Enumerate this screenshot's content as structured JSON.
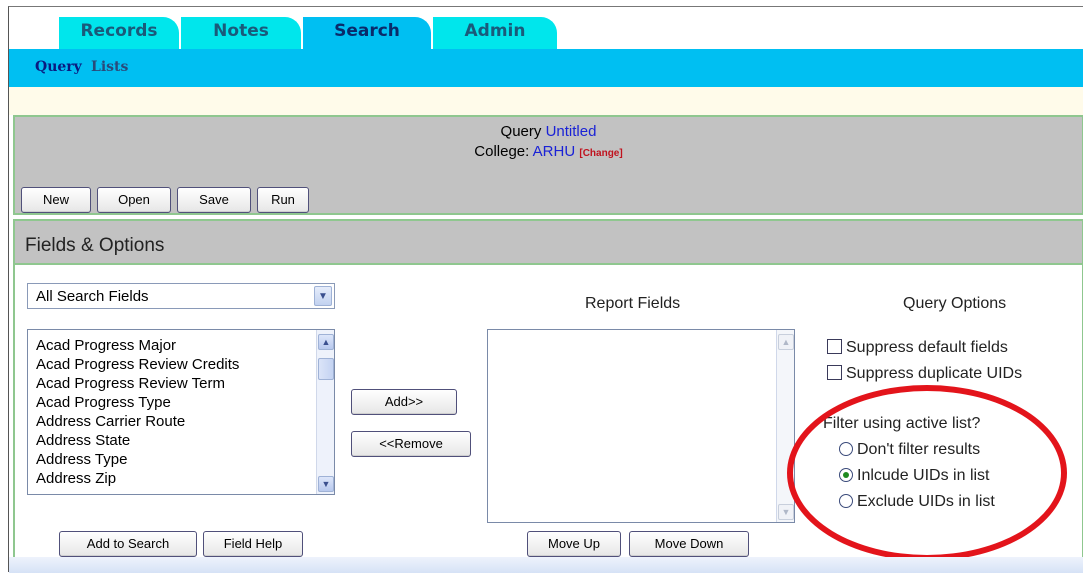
{
  "tabs": [
    {
      "label": "Records"
    },
    {
      "label": "Notes"
    },
    {
      "label": "Search"
    },
    {
      "label": "Admin"
    }
  ],
  "active_tab": "Search",
  "subnav": {
    "query": "Query",
    "lists": "Lists"
  },
  "query": {
    "prefix": "Query",
    "name": "Untitled",
    "college_label": "College:",
    "college": "ARHU",
    "change_link": "[Change]"
  },
  "toolbar": {
    "new": "New",
    "open": "Open",
    "save": "Save",
    "run": "Run"
  },
  "fields_section": {
    "title": "Fields & Options"
  },
  "field_select": {
    "selected": "All Search Fields"
  },
  "search_fields": [
    "Acad Progress Major",
    "Acad Progress Review Credits",
    "Acad Progress Review Term",
    "Acad Progress Type",
    "Address Carrier Route",
    "Address State",
    "Address Type",
    "Address Zip"
  ],
  "buttons": {
    "add": "Add>>",
    "remove": "<<Remove",
    "add_to_search": "Add to Search",
    "field_help": "Field Help",
    "move_up": "Move Up",
    "move_down": "Move Down"
  },
  "report_fields": {
    "title": "Report Fields",
    "items": []
  },
  "query_options": {
    "title": "Query Options",
    "suppress_default": "Suppress default fields",
    "suppress_duplicate": "Suppress duplicate UIDs",
    "filter_label": "Filter using active list?",
    "radios": [
      {
        "label": "Don't filter results",
        "selected": false
      },
      {
        "label": "Inlcude UIDs in list",
        "selected": true
      },
      {
        "label": "Exclude UIDs in list",
        "selected": false
      }
    ]
  },
  "colors": {
    "tab": "#00e6ec",
    "tab_active": "#00bff2",
    "panel": "#c2c2c2",
    "highlight_ellipse": "#e3141b"
  }
}
